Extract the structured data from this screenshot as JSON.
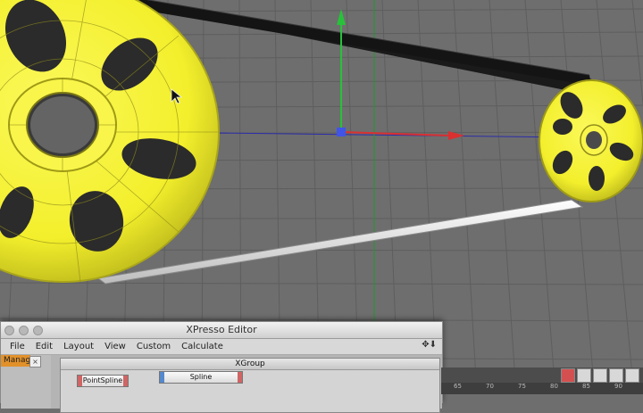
{
  "viewport": {
    "background": "#6e6e6e",
    "grid_color": "#5e5e5e",
    "object_color": "#f5f233",
    "belt_dark": "#1a1a1a",
    "belt_light": "#f2f2f2",
    "axis_y_color": "#27c23a",
    "axis_x_color": "#d93030"
  },
  "xpresso": {
    "title": "XPresso Editor",
    "menu": [
      "File",
      "Edit",
      "Layout",
      "View",
      "Custom",
      "Calculate"
    ],
    "tab_label": "Manager",
    "group_title": "XGroup",
    "nodes": [
      {
        "label": "PointSpline",
        "color": "#d06565"
      },
      {
        "label": "Spline",
        "color": "#5588cc"
      }
    ]
  },
  "timeline": {
    "ticks": [
      "65",
      "70",
      "75",
      "80",
      "85",
      "90"
    ]
  }
}
